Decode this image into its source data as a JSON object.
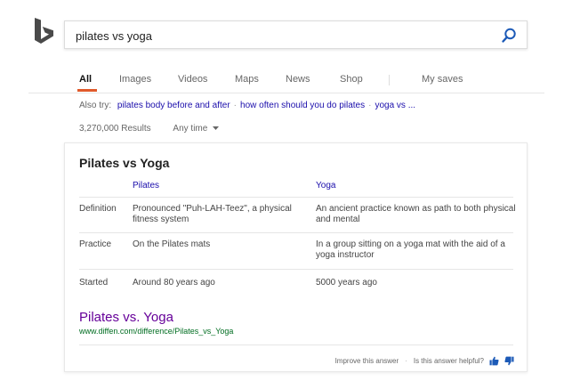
{
  "brand": {
    "name": "Bing"
  },
  "search": {
    "query": "pilates vs yoga"
  },
  "tabs": [
    {
      "label": "All",
      "active": true
    },
    {
      "label": "Images"
    },
    {
      "label": "Videos"
    },
    {
      "label": "Maps"
    },
    {
      "label": "News"
    },
    {
      "label": "Shop"
    },
    {
      "label": "My saves"
    }
  ],
  "also_try": {
    "prefix": "Also try:",
    "links": [
      "pilates body before and after",
      "how often should you do pilates",
      "yoga vs ..."
    ]
  },
  "results": {
    "count": "3,270,000 Results",
    "time_filter": "Any time"
  },
  "answer_card": {
    "title": "Pilates vs Yoga",
    "columns": [
      "Pilates",
      "Yoga"
    ],
    "rows": [
      {
        "label": "Definition",
        "pilates": "Pronounced \"Puh-LAH-Teez\", a physical fitness system",
        "yoga": "An ancient practice known as path to both physical and mental"
      },
      {
        "label": "Practice",
        "pilates": "On the Pilates mats",
        "yoga": "In a group sitting on a yoga mat with the aid of a yoga instructor"
      },
      {
        "label": "Started",
        "pilates": "Around 80 years ago",
        "yoga": "5000 years ago"
      }
    ],
    "source_title": "Pilates vs. Yoga",
    "source_url": "www.diffen.com/difference/Pilates_vs_Yoga",
    "improve": "Improve this answer",
    "helpful": "Is this answer helpful?"
  },
  "colors": {
    "accent": "#e05a2b",
    "link": "#1a0dab",
    "visited": "#660099",
    "url": "#006d21",
    "icon": "#1c5ab7"
  },
  "icons": {
    "logo": "bing-logo",
    "search": "search-icon",
    "caret": "caret-down-icon",
    "thumbs_up": "thumbs-up-icon",
    "thumbs_down": "thumbs-down-icon"
  }
}
